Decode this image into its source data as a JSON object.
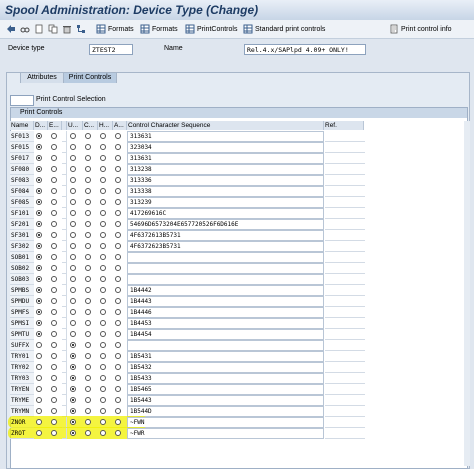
{
  "window": {
    "title": "Spool Administration: Device Type (Change)"
  },
  "toolbar": {
    "formats_label": "Formats",
    "formats2_label": "Formats",
    "printcontrols_label": "PrintControls",
    "standard_label": "Standard print controls",
    "printinfo_label": "Print control info"
  },
  "header": {
    "device_type_label": "Device type",
    "device_type_value": "ZTEST2",
    "name_label": "Name",
    "name_value": "Rel.4.x/SAPlpd 4.09+ ONLY!"
  },
  "tabs": {
    "attributes": "Attributes",
    "print_controls": "Print Controls"
  },
  "selection": {
    "label": "Print Control Selection",
    "value": ""
  },
  "group": {
    "title": "Print Controls"
  },
  "columns": {
    "name": "Name",
    "d": "D...",
    "e": "E...",
    "u": "U...",
    "c": "C...",
    "h": "H...",
    "a": "A...",
    "sequence": "Control Character Sequence",
    "ref": "Ref."
  },
  "rows": [
    {
      "name": "SF013",
      "sel": 0,
      "seq": "313631"
    },
    {
      "name": "SF015",
      "sel": 0,
      "seq": "323034"
    },
    {
      "name": "SF017",
      "sel": 0,
      "seq": "313631"
    },
    {
      "name": "SF080",
      "sel": 0,
      "seq": "313238"
    },
    {
      "name": "SF083",
      "sel": 0,
      "seq": "313336"
    },
    {
      "name": "SF084",
      "sel": 0,
      "seq": "313338"
    },
    {
      "name": "SF085",
      "sel": 0,
      "seq": "313239"
    },
    {
      "name": "SF101",
      "sel": 0,
      "seq": "417269616C"
    },
    {
      "name": "SF201",
      "sel": 0,
      "seq": "54696D6573204E657720526F6D616E"
    },
    {
      "name": "SF301",
      "sel": 0,
      "seq": "4F6372613B5731"
    },
    {
      "name": "SF302",
      "sel": 0,
      "seq": "4F6372623B5731"
    },
    {
      "name": "SOB01",
      "sel": 0,
      "seq": ""
    },
    {
      "name": "SOB02",
      "sel": 0,
      "seq": ""
    },
    {
      "name": "SOB03",
      "sel": 0,
      "seq": ""
    },
    {
      "name": "SPMBS",
      "sel": 0,
      "seq": "1B4442"
    },
    {
      "name": "SPMDU",
      "sel": 0,
      "seq": "1B4443"
    },
    {
      "name": "SPMFS",
      "sel": 0,
      "seq": "1B4446"
    },
    {
      "name": "SPMSI",
      "sel": 0,
      "seq": "1B4453"
    },
    {
      "name": "SPMTU",
      "sel": 0,
      "seq": "1B4454"
    },
    {
      "name": "SUFFX",
      "sel": 2,
      "seq": ""
    },
    {
      "name": "TRY01",
      "sel": 2,
      "seq": "1B5431"
    },
    {
      "name": "TRY02",
      "sel": 2,
      "seq": "1B5432"
    },
    {
      "name": "TRY03",
      "sel": 2,
      "seq": "1B5433"
    },
    {
      "name": "TRYEN",
      "sel": 2,
      "seq": "1B5465"
    },
    {
      "name": "TRYME",
      "sel": 2,
      "seq": "1B5443"
    },
    {
      "name": "TRYMN",
      "sel": 2,
      "seq": "1B544D"
    },
    {
      "name": "ZNOR",
      "sel": 2,
      "seq": "~FWN",
      "highlight": true
    },
    {
      "name": "ZROT",
      "sel": 2,
      "seq": "~FWR",
      "highlight": true
    }
  ],
  "colors": {
    "highlight": "#f0f000",
    "title": "#1e3c64"
  }
}
